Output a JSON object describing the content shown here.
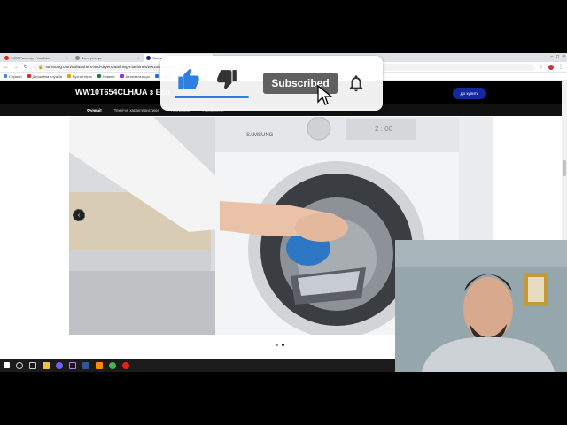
{
  "browser": {
    "tabs": [
      {
        "label": "ТКТОРиелтор - YouTube",
        "color": "#e62117",
        "active": false
      },
      {
        "label": "Фото ресурс",
        "color": "#888888",
        "active": false
      },
      {
        "label": "Samsung",
        "color": "#1428a0",
        "active": true
      }
    ],
    "url": "samsung.com/ua/washers-and-dryers/washing-machines/ww10t654clh-ua/",
    "bookmarks": [
      {
        "label": "Сервіси",
        "color": "#4285f4"
      },
      {
        "label": "Державна служба",
        "color": "#d93025"
      },
      {
        "label": "Бухгалтерія",
        "color": "#f29900"
      },
      {
        "label": "Новини",
        "color": "#188038"
      },
      {
        "label": "Автоматизація",
        "color": "#9334e6"
      },
      {
        "label": "Прийом",
        "color": "#1a73e8"
      },
      {
        "label": "Інші закладки",
        "color": "#f9ab00"
      }
    ]
  },
  "site": {
    "product_title": "WW10T654CLH/UA з Eco",
    "buy_label": "До купити",
    "subnav": [
      {
        "label": "Функції",
        "active": true
      },
      {
        "label": "Технічні характеристики",
        "active": false
      },
      {
        "label": "Підтримка",
        "active": false
      },
      {
        "label": "Порівняння",
        "active": false
      }
    ],
    "display_readout": "2 : 00",
    "brand": "SAMSUNG"
  },
  "overlay": {
    "subscribed_label": "Subscribed",
    "accent": "#2f7fe0"
  },
  "taskbar_icons": [
    "windows-icon",
    "search-icon",
    "task-view-icon",
    "explorer-icon",
    "viber-icon",
    "premiere-icon",
    "word-icon",
    "vlc-icon",
    "chrome-icon",
    "youtube-icon"
  ]
}
